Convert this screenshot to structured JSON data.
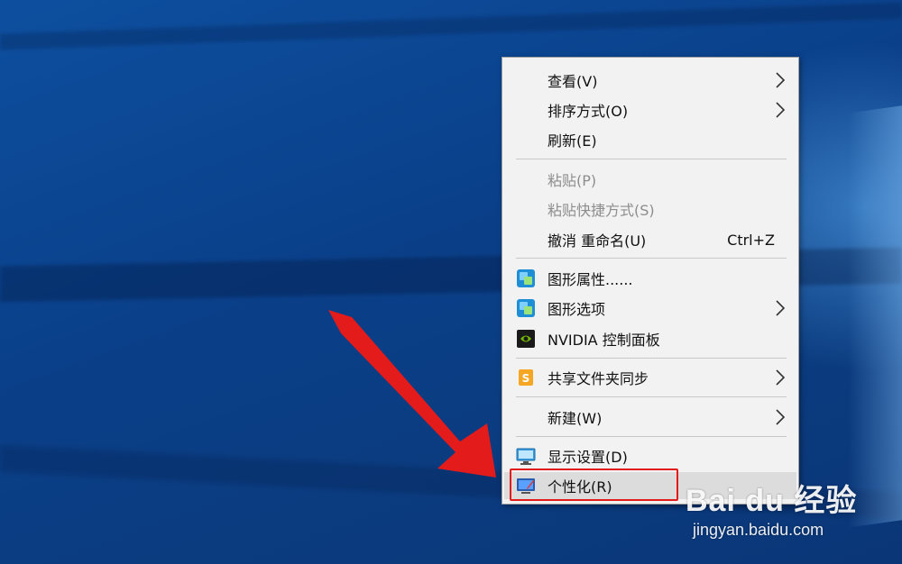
{
  "context_menu": {
    "items": [
      {
        "label": "查看(V)",
        "submenu": true
      },
      {
        "label": "排序方式(O)",
        "submenu": true
      },
      {
        "label": "刷新(E)"
      },
      {
        "label": "粘贴(P)",
        "disabled": true
      },
      {
        "label": "粘贴快捷方式(S)",
        "disabled": true
      },
      {
        "label": "撤消 重命名(U)",
        "shortcut": "Ctrl+Z"
      },
      {
        "label": "图形属性......",
        "icon": "intel-graphics-icon"
      },
      {
        "label": "图形选项",
        "icon": "intel-graphics-icon",
        "submenu": true
      },
      {
        "label": "NVIDIA 控制面板",
        "icon": "nvidia-icon"
      },
      {
        "label": "共享文件夹同步",
        "icon": "sync-folder-icon",
        "submenu": true
      },
      {
        "label": "新建(W)",
        "submenu": true
      },
      {
        "label": "显示设置(D)",
        "icon": "display-settings-icon"
      },
      {
        "label": "个性化(R)",
        "icon": "personalize-icon",
        "highlighted": true
      }
    ]
  },
  "annotation": {
    "color": "#e31b1b"
  },
  "watermark": {
    "logo": "Bai du 经验",
    "url": "jingyan.baidu.com"
  }
}
